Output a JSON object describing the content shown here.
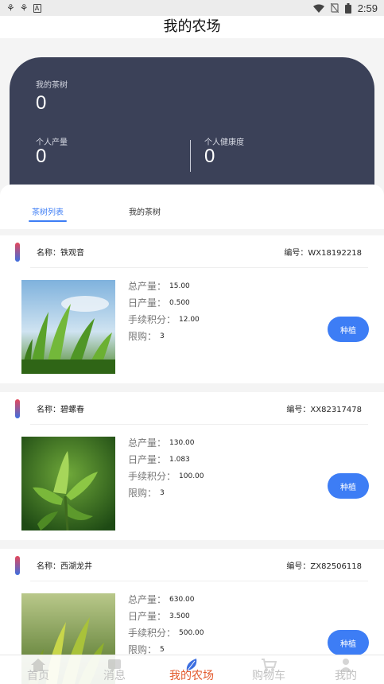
{
  "status_bar": {
    "time": "2:59",
    "left_icons": [
      "bug-icon",
      "bug-icon",
      "a-box-icon"
    ],
    "right_icons": [
      "wifi-icon",
      "no-sim-icon",
      "battery-icon"
    ]
  },
  "header": {
    "title": "我的农场"
  },
  "summary": {
    "my_trees_label": "我的茶树",
    "my_trees_value": "0",
    "output_label": "个人产量",
    "output_value": "0",
    "health_label": "个人健康度",
    "health_value": "0"
  },
  "tabs": [
    {
      "label": "茶树列表",
      "active": true
    },
    {
      "label": "我的茶树",
      "active": false
    }
  ],
  "stat_labels": {
    "total": "总产量：",
    "daily": "日产量：",
    "fee": "手续积分：",
    "limit": "限购："
  },
  "tea_items": [
    {
      "name": "名称：铁观音",
      "code": "编号：WX18192218",
      "total": "15.00",
      "daily": "0.500",
      "fee": "12.00",
      "limit": "3",
      "button": "种植"
    },
    {
      "name": "名称：碧螺春",
      "code": "编号：XX82317478",
      "total": "130.00",
      "daily": "1.083",
      "fee": "100.00",
      "limit": "3",
      "button": "种植"
    },
    {
      "name": "名称：西湖龙井",
      "code": "编号：ZX82506118",
      "total": "630.00",
      "daily": "3.500",
      "fee": "500.00",
      "limit": "5",
      "button": "种植"
    }
  ],
  "bottom_nav": [
    {
      "label": "首页",
      "icon": "home-icon",
      "active": false
    },
    {
      "label": "消息",
      "icon": "message-icon",
      "active": false
    },
    {
      "label": "我的农场",
      "icon": "leaf-icon",
      "active": true
    },
    {
      "label": "购物车",
      "icon": "cart-icon",
      "active": false
    },
    {
      "label": "我的",
      "icon": "user-icon",
      "active": false
    }
  ],
  "colors": {
    "accent": "#3d7df5",
    "card_dark": "#3b4158",
    "nav_active": "#e35a2c"
  }
}
